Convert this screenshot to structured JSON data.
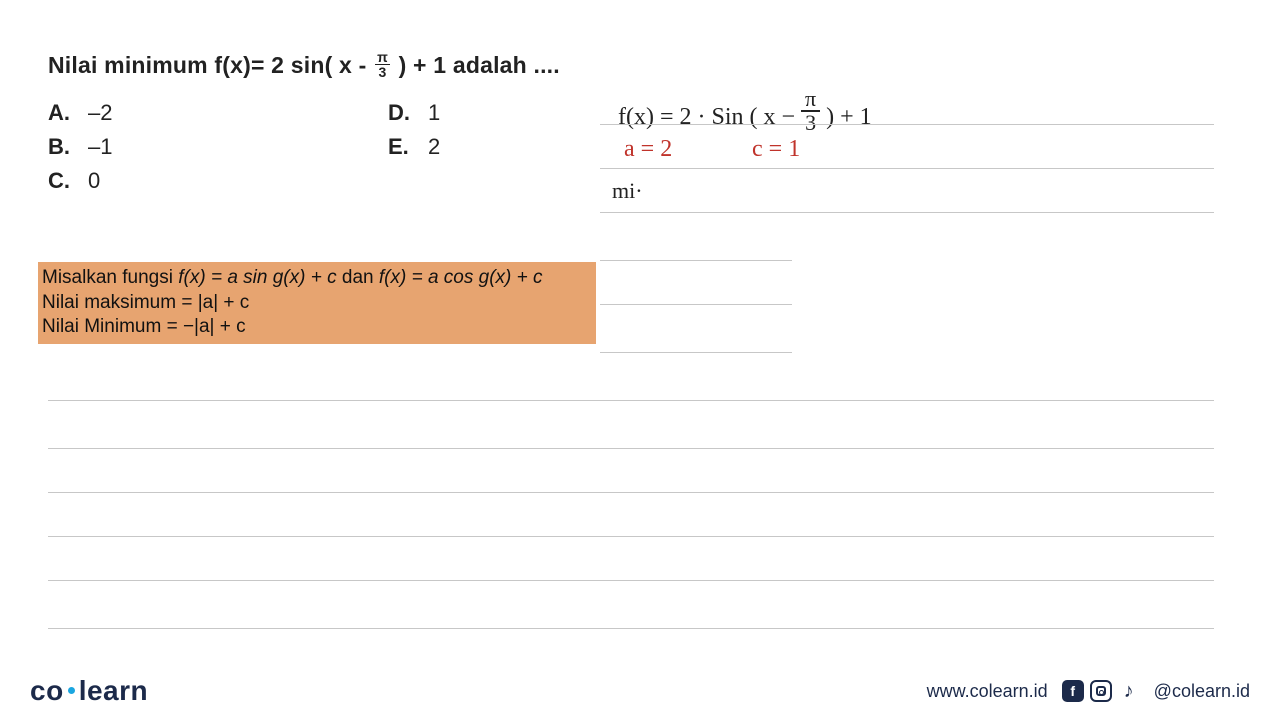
{
  "question": {
    "prefix": "Nilai minimum f(x)= 2 sin( x - ",
    "frac_top": "π",
    "frac_bot": "3",
    "suffix": " ) + 1 adalah ...."
  },
  "options": {
    "A": {
      "letter": "A.",
      "value": "–2"
    },
    "B": {
      "letter": "B.",
      "value": "–1"
    },
    "C": {
      "letter": "C.",
      "value": "0"
    },
    "D": {
      "letter": "D.",
      "value": "1"
    },
    "E": {
      "letter": "E.",
      "value": "2"
    }
  },
  "formula": {
    "line1_a": "Misalkan fungsi ",
    "line1_b": "f(x) = a sin g(x) + c",
    "line1_c": "  dan ",
    "line1_d": "f(x) = a cos g(x) + c",
    "line2": "Nilai maksimum = |a| + c",
    "line3": "Nilai Minimum = −|a| + c"
  },
  "handwriting": {
    "eq_prefix": "f(x) = 2 · Sin ( x − ",
    "eq_frac_top": "π",
    "eq_frac_bot": "3",
    "eq_suffix": " ) + 1",
    "a_label": "a = 2",
    "c_label": "c =  1",
    "mi": "mi·"
  },
  "footer": {
    "logo_co": "co",
    "logo_learn": "learn",
    "url": "www.colearn.id",
    "fb": "f",
    "tk": "♪",
    "handle": "@colearn.id"
  }
}
